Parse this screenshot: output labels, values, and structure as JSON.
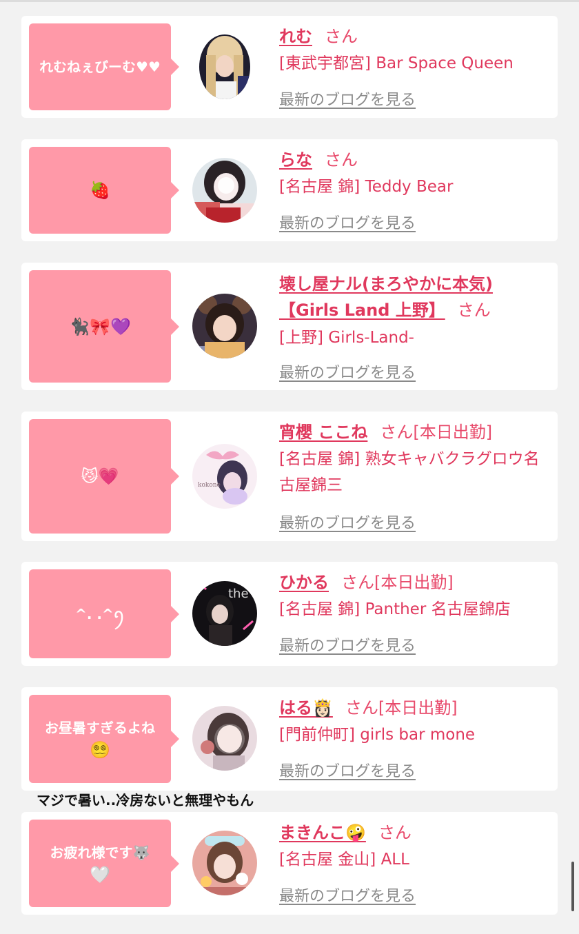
{
  "entries": [
    {
      "bubble": "れむねぇびーむ♥♥",
      "bubble_emoji": "",
      "name": "れむ",
      "name_emoji": "",
      "san": "さん",
      "status": "",
      "shop": "[東武宇都宮] Bar Space Queen",
      "blog": "最新のブログを見る"
    },
    {
      "bubble": "",
      "bubble_emoji": "🍓",
      "name": "らな",
      "name_emoji": "",
      "san": "さん",
      "status": "",
      "shop": "[名古屋 錦] Teddy Bear",
      "blog": "最新のブログを見る"
    },
    {
      "bubble": "",
      "bubble_emoji": "🐈‍⬛🎀💜",
      "name": "壊し屋ナル(まろやかに本気)【Girls Land 上野】",
      "name_emoji": "",
      "san": "さん",
      "status": "",
      "shop": "[上野] Girls-Land-",
      "blog": "最新のブログを見る"
    },
    {
      "bubble": "",
      "bubble_emoji": "😼💗",
      "name": "宵櫻 ここね",
      "name_emoji": "",
      "san": "さん",
      "status": "[本日出勤]",
      "shop": "[名古屋 錦] 熟女キャバクラグロウ名古屋錦三",
      "blog": "最新のブログを見る"
    },
    {
      "bubble": "^. .^ꪆ",
      "bubble_emoji": "",
      "name": "ひかる",
      "name_emoji": "",
      "san": "さん",
      "status": "[本日出勤]",
      "shop": "[名古屋 錦] Panther 名古屋錦店",
      "blog": "最新のブログを見る"
    },
    {
      "bubble": "お昼暑すぎるよね",
      "bubble_emoji": "😵‍💫",
      "name": "はる",
      "name_emoji": "👸🏻",
      "san": "さん",
      "status": "[本日出勤]",
      "shop": "[門前仲町] girls bar mone",
      "blog": "最新のブログを見る"
    },
    {
      "bubble": "お疲れ様です🐺",
      "bubble_emoji": "🤍",
      "name": "まきんこ",
      "name_emoji": "🤪",
      "san": "さん",
      "status": "",
      "shop": "[名古屋 金山] ALL",
      "blog": "最新のブログを見る"
    }
  ],
  "overflow_text": "マジで暑い..冷房ないと無理やもん",
  "colors": {
    "accent": "#e0385d",
    "bubble": "#ff99a8",
    "background": "#f2f2f2"
  }
}
